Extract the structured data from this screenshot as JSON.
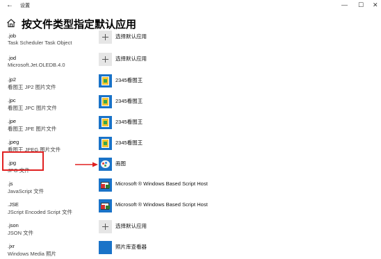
{
  "window": {
    "back_glyph": "←",
    "title": "设置",
    "minimize_glyph": "—",
    "maximize_glyph": "☐",
    "close_glyph": "✕"
  },
  "page": {
    "title": "按文件类型指定默认应用",
    "home_icon": "home-icon"
  },
  "rows": [
    {
      "ext": ".job",
      "desc": "Task Scheduler Task Object",
      "app": "选择默认应用",
      "icon": "plus"
    },
    {
      "ext": ".jod",
      "desc": "Microsoft.Jet.OLEDB.4.0",
      "app": "选择默认应用",
      "icon": "plus"
    },
    {
      "ext": ".jp2",
      "desc": "看图王 JP2 图片文件",
      "app": "2345看图王",
      "icon": "viewer"
    },
    {
      "ext": ".jpc",
      "desc": "看图王 JPC 图片文件",
      "app": "2345看图王",
      "icon": "viewer"
    },
    {
      "ext": ".jpe",
      "desc": "看图王 JPE 图片文件",
      "app": "2345看图王",
      "icon": "viewer"
    },
    {
      "ext": ".jpeg",
      "desc": "看图王 JPEG 图片文件",
      "app": "2345看图王",
      "icon": "viewer"
    },
    {
      "ext": ".jpg",
      "desc": "JPG 文件",
      "app": "画图",
      "icon": "paint"
    },
    {
      "ext": ".js",
      "desc": "JavaScript 文件",
      "app": "Microsoft ® Windows Based Script Host",
      "icon": "script"
    },
    {
      "ext": ".JSE",
      "desc": "JScript Encoded Script 文件",
      "app": "Microsoft ® Windows Based Script Host",
      "icon": "script"
    },
    {
      "ext": ".json",
      "desc": "JSON 文件",
      "app": "选择默认应用",
      "icon": "plus"
    },
    {
      "ext": ".jxr",
      "desc": "Windows Media 照片",
      "app": "照片库查看器",
      "icon": "photo"
    }
  ],
  "annotation": {
    "highlight_color": "#e02020"
  },
  "colors": {
    "tile_blue": "#1a73c8",
    "tile_plus": "#e6e6e6"
  }
}
